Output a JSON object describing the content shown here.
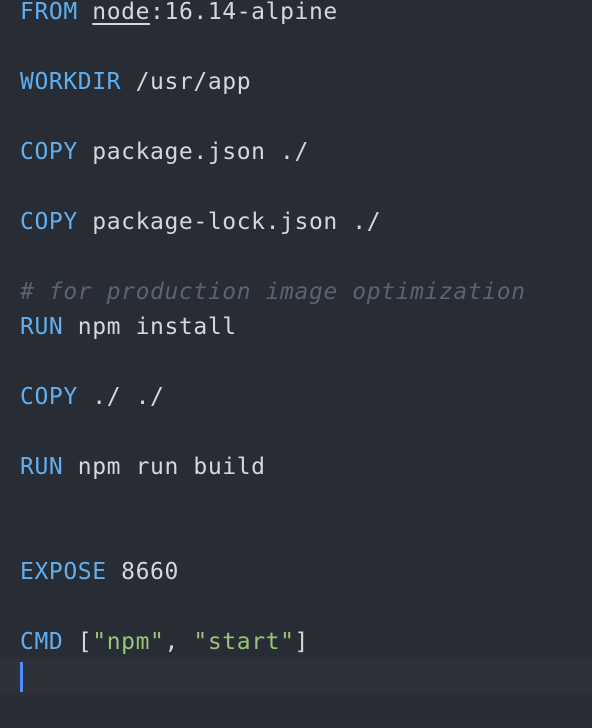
{
  "editor": {
    "lines": [
      {
        "keyword": "FROM",
        "image_name": "node",
        "rest": ":16.14-alpine"
      },
      {
        "keyword": "WORKDIR",
        "rest": " /usr/app"
      },
      {
        "keyword": "COPY",
        "rest": " package.json ./"
      },
      {
        "keyword": "COPY",
        "rest": " package-lock.json ./"
      },
      {
        "comment": "# for production image optimization"
      },
      {
        "keyword": "RUN",
        "rest": " npm install"
      },
      {
        "keyword": "COPY",
        "rest": " ./ ./"
      },
      {
        "keyword": "RUN",
        "rest": " npm run build"
      },
      {
        "keyword": "EXPOSE",
        "rest": " 8660"
      },
      {
        "keyword": "CMD",
        "open": " [",
        "str1": "\"npm\"",
        "sep": ", ",
        "str2": "\"start\"",
        "close": "]"
      }
    ]
  },
  "colors": {
    "background": "#282c34",
    "keyword": "#61afef",
    "text": "#d4d7dd",
    "comment": "#5c6370",
    "string": "#98c379",
    "cursor": "#528bff"
  }
}
